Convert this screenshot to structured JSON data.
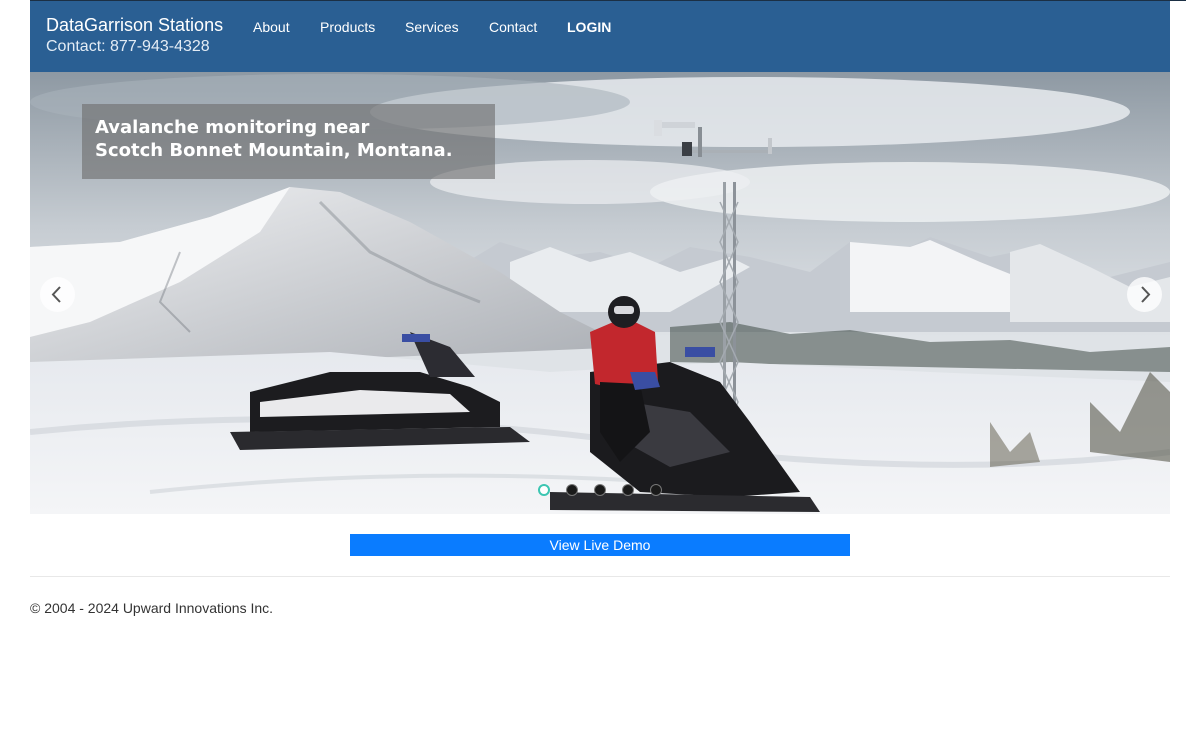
{
  "header": {
    "brand": "DataGarrison Stations",
    "contact": "Contact: 877-943-4328",
    "nav": [
      {
        "label": "About"
      },
      {
        "label": "Products"
      },
      {
        "label": "Services"
      },
      {
        "label": "Contact"
      },
      {
        "label": "LOGIN"
      }
    ],
    "bg_color": "#2a5f93"
  },
  "carousel": {
    "caption_line1": "Avalanche monitoring near",
    "caption_line2": "Scotch Bonnet Mountain, Montana.",
    "slide_count": 5,
    "active_slide": 1,
    "prev_icon": "chevron-left-icon",
    "next_icon": "chevron-right-icon"
  },
  "demo": {
    "label": "View Live Demo",
    "color": "#0a7cff"
  },
  "footer": {
    "copyright": "© 2004 - 2024 Upward Innovations Inc."
  }
}
